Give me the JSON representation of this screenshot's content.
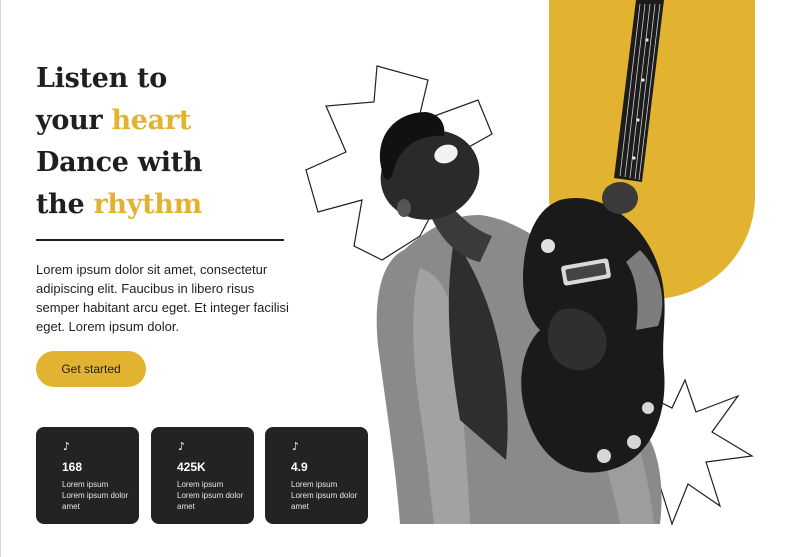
{
  "hero": {
    "headline": [
      {
        "text": "Listen to",
        "accent": ""
      },
      {
        "text": "your ",
        "accent": "heart"
      },
      {
        "text": "Dance with",
        "accent": ""
      },
      {
        "text": "the ",
        "accent": "rhythm"
      }
    ],
    "body": "Lorem ipsum dolor sit amet, consectetur adipiscing elit. Faucibus in libero risus semper habitant arcu eget. Et integer facilisi eget. Lorem ipsum dolor.",
    "cta_label": "Get started"
  },
  "stats": [
    {
      "icon": "music-note-icon",
      "glyph": "♪",
      "value": "168",
      "caption": "Lorem ipsum Lorem ipsum dolor amet"
    },
    {
      "icon": "music-note-icon",
      "glyph": "♪",
      "value": "425K",
      "caption": "Lorem ipsum Lorem ipsum dolor amet"
    },
    {
      "icon": "music-note-icon",
      "glyph": "♪",
      "value": "4.9",
      "caption": "Lorem ipsum Lorem ipsum dolor amet"
    }
  ],
  "colors": {
    "accent": "#e2b331",
    "dark": "#232323",
    "text": "#1f1f1f",
    "background": "#ffffff"
  }
}
